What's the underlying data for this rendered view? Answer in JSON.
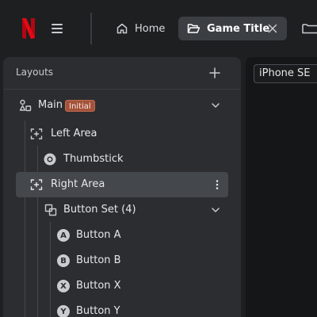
{
  "topbar": {
    "home_label": "Home",
    "game_tab_label": "Game Title",
    "icons": {
      "logo": "netflix-logo-icon",
      "menu": "hamburger-menu-icon",
      "home": "home-icon",
      "folder": "folder-open-icon",
      "close": "close-icon"
    }
  },
  "layouts_panel": {
    "title": "Layouts",
    "add_icon": "plus-icon",
    "tree": [
      {
        "label": "Main",
        "badge": "Initial",
        "icon": "shapes-icon",
        "expanded": true
      },
      {
        "label": "Left Area",
        "icon": "area-select-icon"
      },
      {
        "label": "Thumbstick",
        "icon": "thumbstick-icon"
      },
      {
        "label": "Right Area",
        "icon": "area-select-icon",
        "selected": true
      },
      {
        "label": "Button Set (4)",
        "icon": "button-set-icon",
        "expanded": true
      },
      {
        "label": "Button A",
        "icon": "button-a-icon",
        "letter": "A"
      },
      {
        "label": "Button B",
        "icon": "button-b-icon",
        "letter": "B"
      },
      {
        "label": "Button X",
        "icon": "button-x-icon",
        "letter": "X"
      },
      {
        "label": "Button Y",
        "icon": "button-y-icon",
        "letter": "Y"
      }
    ]
  },
  "canvas": {
    "device": "iPhone SE"
  },
  "colors": {
    "background": "#1e1f21",
    "panel": "#2b2d30",
    "selected_row": "#44474c",
    "badge": "#a4533a",
    "logo_red": "#e50914"
  }
}
